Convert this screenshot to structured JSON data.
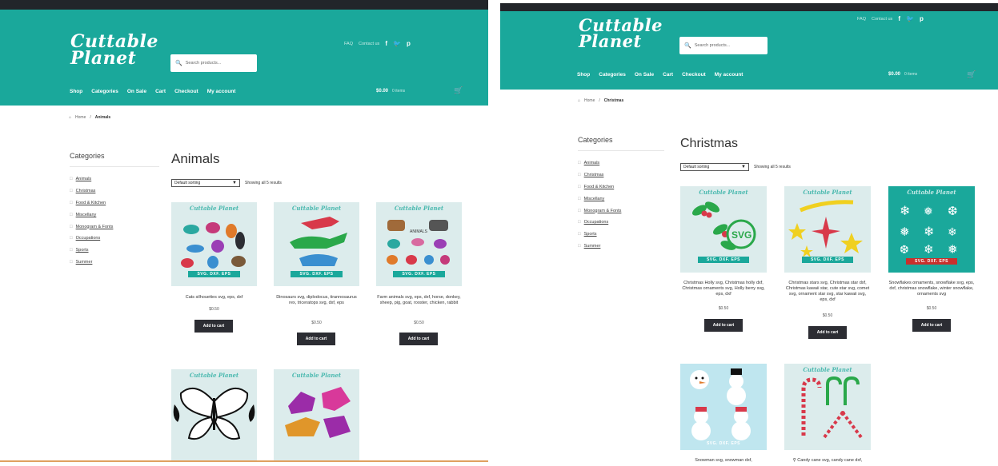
{
  "colors": {
    "brand_teal": "#1aa89b",
    "top_bar": "#22252a",
    "button_dark": "#2c2d33",
    "accent_red": "#c9302c"
  },
  "icons": [
    "search-icon",
    "facebook-icon",
    "twitter-icon",
    "pinterest-icon",
    "basket-icon",
    "home-icon",
    "folder-icon",
    "dropdown-caret-icon"
  ],
  "left": {
    "logo": {
      "line1": "Cuttable",
      "line2": "Planet"
    },
    "search": {
      "placeholder": "Search products..."
    },
    "toplinks": {
      "link1": "FAQ",
      "link2": "Contact us"
    },
    "social": {
      "facebook": "f",
      "twitter": "t",
      "pinterest": "p"
    },
    "nav": {
      "shop": "Shop",
      "categories": "Categories",
      "on_sale": "On Sale",
      "cart": "Cart",
      "checkout": "Checkout",
      "account": "My account"
    },
    "cart": {
      "amount": "$0.00",
      "items": "0 items"
    },
    "breadcrumb": {
      "home": "Home",
      "sep": "/",
      "current": "Animals"
    },
    "sidebar": {
      "title": "Categories",
      "items": [
        {
          "label": "Animals"
        },
        {
          "label": "Christmas"
        },
        {
          "label": "Food & Kitchen"
        },
        {
          "label": "Miscellany"
        },
        {
          "label": "Monogram & Fonts"
        },
        {
          "label": "Occupations"
        },
        {
          "label": "Sports"
        },
        {
          "label": "Summer"
        }
      ]
    },
    "page_title": "Animals",
    "sort": {
      "selected": "Default sorting",
      "count": "Showing all 5 results"
    },
    "products": [
      {
        "brand": "Cuttable Planet",
        "banner": "SVG. DXF. EPS",
        "name": "Cats silhouettes svg, eps, dxf",
        "price": "$0.50",
        "button": "Add to cart"
      },
      {
        "brand": "Cuttable Planet",
        "banner": "SVG. DXF. EPS",
        "name": "Dinosaurs svg, diplodocus, tirannosaurus rex, triceratops svg, dxf, eps",
        "price": "$0.50",
        "button": "Add to cart"
      },
      {
        "brand": "Cuttable Planet",
        "banner": "SVG. DXF. EPS",
        "name": "Farm animals svg, eps, dxf, horse, donkey, sheep, pig, goat, rooster, chicken, rabbit",
        "price": "$0.50",
        "button": "Add to cart"
      },
      {
        "brand": "Cuttable Planet",
        "banner": "",
        "name": "",
        "price": "",
        "button": ""
      },
      {
        "brand": "Cuttable Planet",
        "banner": "",
        "name": "",
        "price": "",
        "button": ""
      }
    ]
  },
  "right": {
    "logo": {
      "line1": "Cuttable",
      "line2": "Planet"
    },
    "search": {
      "placeholder": "Search products..."
    },
    "toplinks": {
      "link1": "FAQ",
      "link2": "Contact us"
    },
    "social": {
      "facebook": "f",
      "twitter": "t",
      "pinterest": "p"
    },
    "nav": {
      "shop": "Shop",
      "categories": "Categories",
      "on_sale": "On Sale",
      "cart": "Cart",
      "checkout": "Checkout",
      "account": "My account"
    },
    "cart": {
      "amount": "$0.00",
      "items": "0 items"
    },
    "breadcrumb": {
      "home": "Home",
      "sep": "/",
      "current": "Christmas"
    },
    "sidebar": {
      "title": "Categories",
      "items": [
        {
          "label": "Animals"
        },
        {
          "label": "Christmas"
        },
        {
          "label": "Food & Kitchen"
        },
        {
          "label": "Miscellany"
        },
        {
          "label": "Monogram & Fonts"
        },
        {
          "label": "Occupations"
        },
        {
          "label": "Sports"
        },
        {
          "label": "Summer"
        }
      ]
    },
    "page_title": "Christmas",
    "sort": {
      "selected": "Default sorting",
      "count": "Showing all 5 results"
    },
    "products": [
      {
        "brand": "Cuttable Planet",
        "banner": "SVG. DXF. EPS",
        "name": "Christmas Holly svg, Christmas holly dxf, Christmas ornaments svg, Holly berry svg, eps, dxf",
        "price": "$0.50",
        "button": "Add to cart"
      },
      {
        "brand": "Cuttable Planet",
        "banner": "SVG. DXF. EPS",
        "name": "Christmas stars svg, Christmas star dxf, Christmas kawaii star, cute star svg, comet svg, ornament star svg, star kawaii svg, eps, dxf",
        "price": "$0.50",
        "button": "Add to cart"
      },
      {
        "brand": "Cuttable Planet",
        "banner": "SVG. DXF. EPS",
        "name": "Snowflakes ornaments, snowflake svg, eps, dxf, christmas snowflake, winter snowflake, ornaments svg",
        "price": "$0.50",
        "button": "Add to cart"
      },
      {
        "brand": "",
        "banner": "SVG. DXF. EPS",
        "name": "Snowman svg, snowman dxf,",
        "price": "",
        "button": ""
      },
      {
        "brand": "Cuttable Planet",
        "banner": "",
        "name": "Candy cane svg, candy cane dxf,",
        "price": "",
        "button": ""
      }
    ]
  }
}
